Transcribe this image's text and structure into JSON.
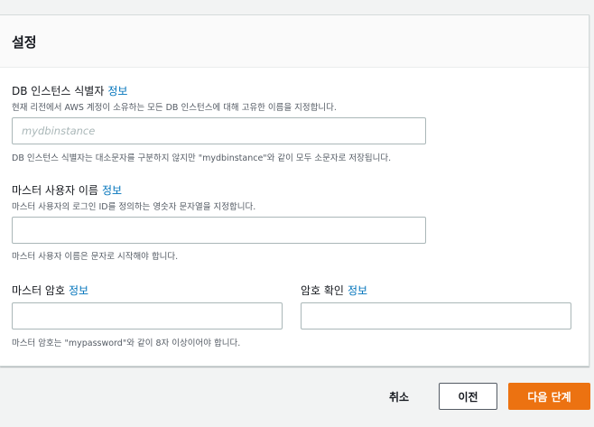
{
  "section": {
    "title": "설정"
  },
  "info_link": "정보",
  "db_identifier": {
    "label": "DB 인스턴스 식별자",
    "description": "현재 리전에서 AWS 계정이 소유하는 모든 DB 인스턴스에 대해 고유한 이름을 지정합니다.",
    "placeholder": "mydbinstance",
    "value": "",
    "hint": "DB 인스턴스 식별자는 대소문자를 구분하지 않지만 \"mydbinstance\"와 같이 모두 소문자로 저장됩니다."
  },
  "master_username": {
    "label": "마스터 사용자 이름",
    "description": "마스터 사용자의 로그인 ID를 정의하는 영숫자 문자열을 지정합니다.",
    "value": "",
    "hint": "마스터 사용자 이름은 문자로 시작해야 합니다."
  },
  "master_password": {
    "label": "마스터 암호",
    "value": "",
    "hint": "마스터 암호는 \"mypassword\"와 같이 8자 이상이어야 합니다."
  },
  "confirm_password": {
    "label": "암호 확인",
    "value": ""
  },
  "footer": {
    "cancel_label": "취소",
    "previous_label": "이전",
    "next_label": "다음 단계"
  },
  "colors": {
    "link": "#0073bb",
    "primary_button": "#ec7211"
  }
}
